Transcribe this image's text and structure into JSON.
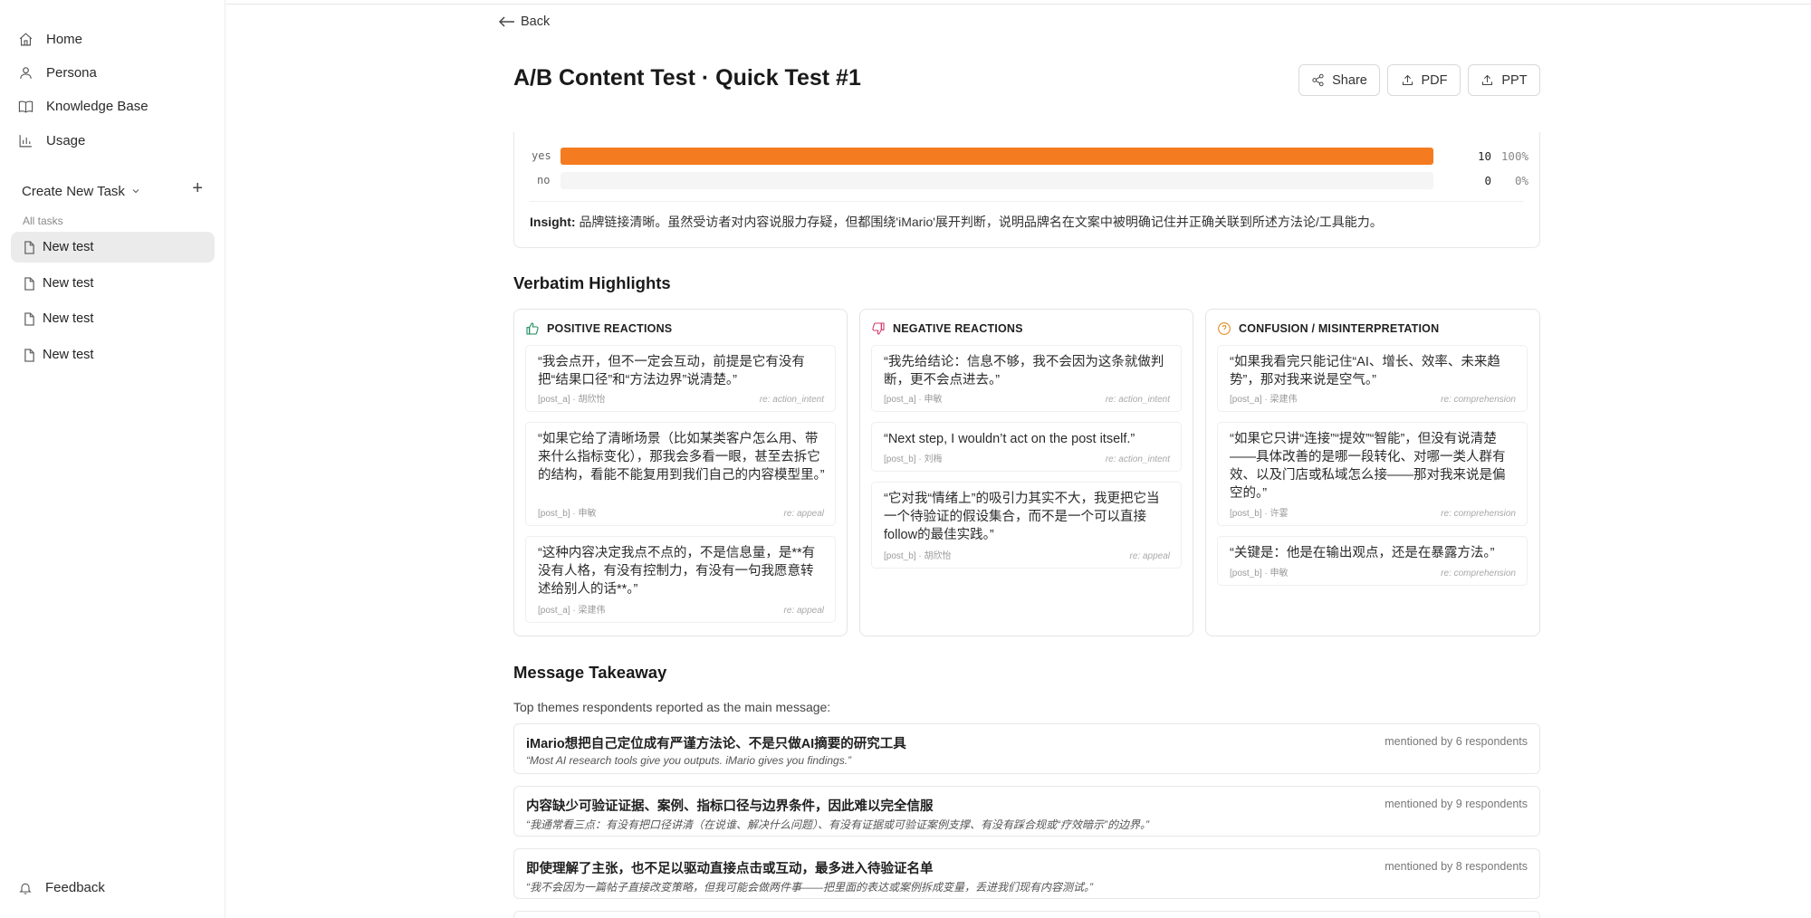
{
  "sidebar": {
    "nav": [
      {
        "label": "Home",
        "icon": "home-icon"
      },
      {
        "label": "Persona",
        "icon": "user-icon"
      },
      {
        "label": "Knowledge Base",
        "icon": "book-icon"
      },
      {
        "label": "Usage",
        "icon": "bar-chart-icon"
      }
    ],
    "create_task_label": "Create New Task",
    "all_tasks_label": "All tasks",
    "tasks": [
      "New test",
      "New test",
      "New test",
      "New test"
    ],
    "feedback_label": "Feedback"
  },
  "header": {
    "back_label": "Back",
    "title": "A/B Content Test · Quick Test #1",
    "share_label": "Share",
    "pdf_label": "PDF",
    "ppt_label": "PPT"
  },
  "results": {
    "bars": [
      {
        "label": "yes",
        "count": "10",
        "pct": "100%",
        "fraction": 1.0
      },
      {
        "label": "no",
        "count": "0",
        "pct": "0%",
        "fraction": 0.0
      }
    ],
    "bar_color": "#f47b20",
    "insight_label": "Insight:",
    "insight_text": "品牌链接清晰。虽然受访者对内容说服力存疑，但都围绕'iMario'展开判断，说明品牌名在文案中被明确记住并正确关联到所述方法论/工具能力。"
  },
  "verbatim": {
    "title": "Verbatim Highlights",
    "columns": [
      {
        "heading": "POSITIVE REACTIONS",
        "icon": "thumbs-up-icon",
        "color": "#1a8a5a",
        "quotes": [
          {
            "text": "“我会点开，但不一定会互动，前提是它有没有把“结果口径”和“方法边界”说清楚。”",
            "source": "[post_a] · 胡欣怡",
            "re": "re: action_intent"
          },
          {
            "text": "“如果它给了清晰场景（比如某类客户怎么用、带来什么指标变化），那我会多看一眼，甚至去拆它的结构，看能不能复用到我们自己的内容模型里。”",
            "source": "[post_b] · 申敏",
            "re": "re: appeal"
          },
          {
            "text": "“这种内容决定我点不点的，不是信息量，是**有没有人格，有没有控制力，有没有一句我愿意转述给别人的话**。”",
            "source": "[post_a] · 梁建伟",
            "re": "re: appeal"
          }
        ]
      },
      {
        "heading": "NEGATIVE REACTIONS",
        "icon": "thumbs-down-icon",
        "color": "#d6336c",
        "quotes": [
          {
            "text": "“我先给结论：信息不够，我不会因为这条就做判断，更不会点进去。”",
            "source": "[post_a] · 申敏",
            "re": "re: action_intent"
          },
          {
            "text": "“Next step, I wouldn’t act on the post itself.”",
            "source": "[post_b] · 刘梅",
            "re": "re: action_intent"
          },
          {
            "text": "“它对我“情绪上”的吸引力其实不大，我更把它当一个待验证的假设集合，而不是一个可以直接follow的最佳实践。”",
            "source": "[post_b] · 胡欣怡",
            "re": "re: appeal"
          }
        ]
      },
      {
        "heading": "CONFUSION / MISINTERPRETATION",
        "icon": "question-circle-icon",
        "color": "#e08a1e",
        "quotes": [
          {
            "text": "“如果我看完只能记住“AI、增长、效率、未来趋势”，那对我来说是空气。”",
            "source": "[post_a] · 梁建伟",
            "re": "re: comprehension"
          },
          {
            "text": "“如果它只讲“连接”“提效”“智能”，但没有说清楚——具体改善的是哪一段转化、对哪一类人群有效、以及门店或私域怎么接——那对我来说是偏空的。”",
            "source": "[post_b] · 许霎",
            "re": "re: comprehension"
          },
          {
            "text": "“关键是：他是在输出观点，还是在暴露方法。”",
            "source": "[post_b] · 申敏",
            "re": "re: comprehension"
          }
        ]
      }
    ]
  },
  "takeaway": {
    "title": "Message Takeaway",
    "subtitle": "Top themes respondents reported as the main message:",
    "themes": [
      {
        "title": "iMario想把自己定位成有严谨方法论、不是只做AI摘要的研究工具",
        "quote": "“Most AI research tools give you outputs. iMario gives you findings.”",
        "meta": "mentioned by 6 respondents"
      },
      {
        "title": "内容缺少可验证证据、案例、指标口径与边界条件，因此难以完全信服",
        "quote": "“我通常看三点：有没有把口径讲清（在说谁、解决什么问题）、有没有证据或可验证案例支撑、有没有踩合规或“疗效暗示”的边界。”",
        "meta": "mentioned by 9 respondents"
      },
      {
        "title": "即使理解了主张，也不足以驱动直接点击或互动，最多进入待验证名单",
        "quote": "“我不会因为一篇帖子直接改变策略，但我可能会做两件事——把里面的表达或案例拆成变量，丢进我们现有内容测试。”",
        "meta": "mentioned by 8 respondents"
      }
    ]
  }
}
